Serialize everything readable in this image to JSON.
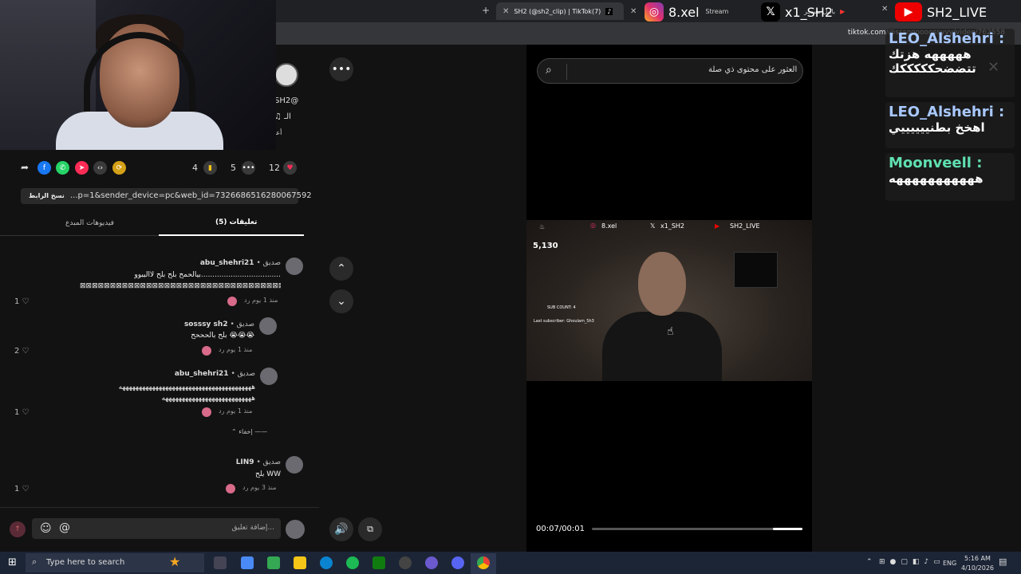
{
  "tabs": [
    {
      "label": "SH2 (@sh2_clip) | TikTok(7)",
      "active": true
    },
    {
      "label": "Stream"
    },
    {
      "label": "بالبل مسجر"
    }
  ],
  "url": "tiktok.com/@sssoooooossyyy/video/762558",
  "social": {
    "instagram": "8.xel",
    "x": "x1_SH2",
    "youtube": "SH2_LIVE"
  },
  "profile": {
    "handle": "SH2@",
    "music": "♫ الـ",
    "extra": "أعـ"
  },
  "actions": {
    "bookmarks": "4",
    "comments": "5",
    "likes": "12"
  },
  "link": {
    "url": "...p=1&sender_device=pc&web_id=7326686516280067592",
    "copy_label": "نسخ الرابط"
  },
  "panel_tabs": {
    "comments": "تعليقات (5)",
    "creator_videos": "فيديوهات المبدع"
  },
  "comments": [
    {
      "user": "abu_shehri21",
      "tag": "صديق",
      "text1": "بيالحمح بلح بلح لااليبوو...................................",
      "text2": "⊠⊠⊠⊠⊠⊠⊠⊠⊠⊠⊠⊠⊠⊠⊠⊠⊠⊠⊠⊠⊠⊠⊠⊠⊠⊠⊠⊠⊠⊠⊠⊠⊠⊠⊠⊠⊠⊠⊠⊠⊠",
      "meta": "منذ 1 يوم   رد",
      "likes": "1"
    },
    {
      "user": "sosssy sh2",
      "tag": "صديق",
      "text1": "بلح بالحححح 😭😭😭",
      "meta": "منذ 1 يوم   رد",
      "likes": "2"
    },
    {
      "user": "abu_shehri21",
      "tag": "صديق",
      "text1": "ههههههههههههههههههههههههههههههههههههههههه",
      "text2": "هههههههههههههههههههههههههههه",
      "meta": "منذ 1 يوم   رد",
      "likes": "1"
    },
    {
      "user": "LIN9",
      "tag": "صديق",
      "text1": "بلح WW",
      "meta": "منذ 3 يوم   رد",
      "likes": "1"
    }
  ],
  "hide_label": "إخفاء",
  "comment_input": {
    "placeholder": "إضافة تعليق..."
  },
  "search": {
    "placeholder": "العثور على محتوى ذي صلة"
  },
  "video_overlay": {
    "views": "5,130",
    "sub_count": "SUB COUNT: 4",
    "last_sub": "Last subscriber: Ghoulam_Sh3",
    "instagram": "8.xel",
    "x": "x1_SH2",
    "youtube": "SH2_LIVE"
  },
  "player": {
    "time": "00:07/00:01",
    "progress": 0.86
  },
  "chat": [
    {
      "name": "LEO_Alshehri",
      "color": "#a8c8ff",
      "message": "هههههه هزتك تتضضحكككككك"
    },
    {
      "name": "LEO_Alshehri",
      "color": "#a8c8ff",
      "message": "اهخخ بطنييييييي"
    },
    {
      "name": "Moonveell",
      "color": "#5fe0b0",
      "message": "هههههههههههه"
    }
  ],
  "taskbar": {
    "search_placeholder": "Type here to search",
    "lang": "ENG",
    "time": "5:16 AM",
    "date": "4/10/2026"
  }
}
